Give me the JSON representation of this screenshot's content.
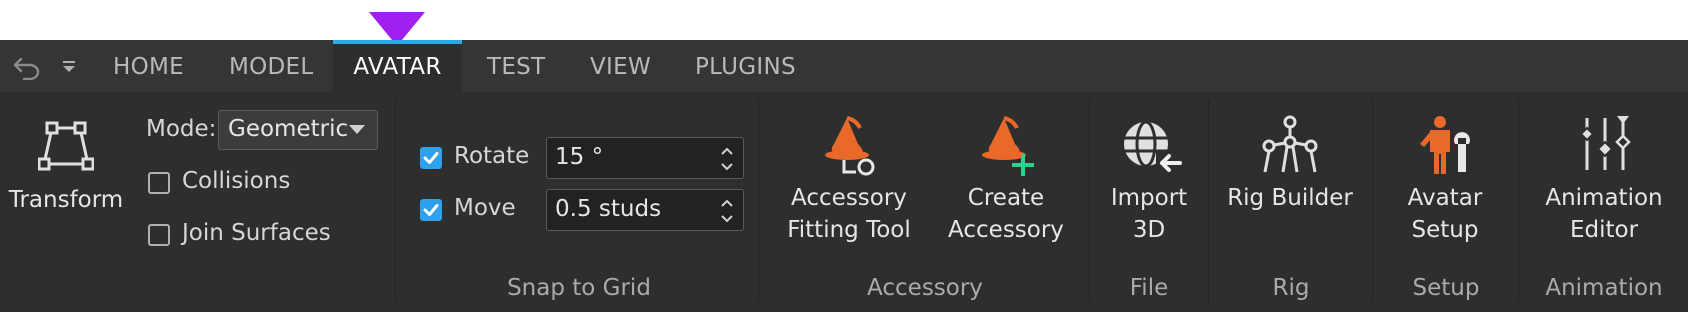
{
  "quick_access": {
    "undo_icon": "undo-icon",
    "customize_icon": "chevron-down-icon"
  },
  "tabs": [
    {
      "label": "HOME"
    },
    {
      "label": "MODEL"
    },
    {
      "label": "AVATAR",
      "active": true
    },
    {
      "label": "TEST"
    },
    {
      "label": "VIEW"
    },
    {
      "label": "PLUGINS"
    }
  ],
  "transform": {
    "button_label": "Transform",
    "mode_label": "Mode:",
    "mode_value": "Geometric",
    "collisions_label": "Collisions",
    "collisions_checked": false,
    "join_surfaces_label": "Join Surfaces",
    "join_surfaces_checked": false
  },
  "snap": {
    "rotate_label": "Rotate",
    "rotate_checked": true,
    "rotate_value": "15 °",
    "move_label": "Move",
    "move_checked": true,
    "move_value": "0.5 studs",
    "group_label": "Snap to Grid"
  },
  "accessory": {
    "fitting_line1": "Accessory",
    "fitting_line2": "Fitting Tool",
    "create_line1": "Create",
    "create_line2": "Accessory",
    "group_label": "Accessory"
  },
  "file": {
    "import_line1": "Import",
    "import_line2": "3D",
    "group_label": "File"
  },
  "rig": {
    "builder_label": "Rig Builder",
    "group_label": "Rig"
  },
  "setup": {
    "avatar_line1": "Avatar",
    "avatar_line2": "Setup",
    "group_label": "Setup"
  },
  "animation": {
    "editor_line1": "Animation",
    "editor_line2": "Editor",
    "group_label": "Animation"
  },
  "colors": {
    "accent": "#2fa8e8",
    "pointer": "#a020f0",
    "orange": "#e8692a",
    "green": "#2ed08a",
    "checkbox": "#2fa0ee"
  }
}
